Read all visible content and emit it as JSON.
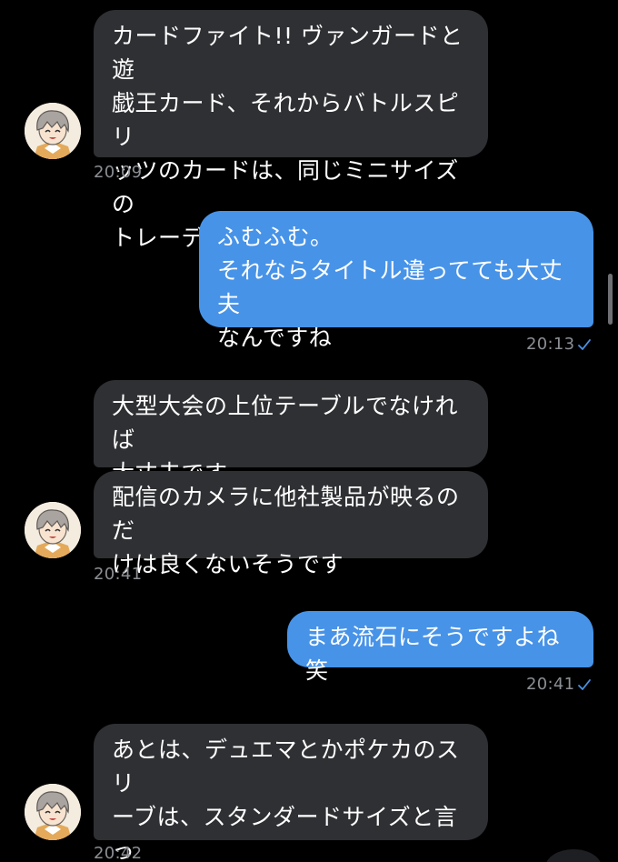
{
  "colors": {
    "background": "#000000",
    "incoming_bubble": "#2f3033",
    "outgoing_bubble": "#4793e8",
    "timestamp": "#8b8e93",
    "read_check": "#4793e8"
  },
  "messages": [
    {
      "direction": "incoming",
      "text": "カードファイト!! ヴァンガードと遊\n戯王カード、それからバトルスピリ\nッツのカードは、同じミニサイズの\nトレーディングカードなんです",
      "time": "20:09"
    },
    {
      "direction": "outgoing",
      "text": "ふむふむ。\nそれならタイトル違ってても大丈夫\nなんですね",
      "time": "20:13",
      "read": true
    },
    {
      "direction": "incoming",
      "text": "大型大会の上位テーブルでなければ\n大丈夫です"
    },
    {
      "direction": "incoming",
      "text": "配信のカメラに他社製品が映るのだ\nけは良くないそうです",
      "time": "20:41"
    },
    {
      "direction": "outgoing",
      "text": "まあ流石にそうですよね笑",
      "time": "20:41",
      "read": true
    },
    {
      "direction": "incoming",
      "text": "あとは、デュエマとかポケカのスリ\nーブは、スタンダードサイズと言っ\nてサイズが異なるのでダメです",
      "time": "20:42"
    }
  ],
  "icons": {
    "avatar": "cartoon-avatar-icon",
    "read_receipt": "checkmark-icon"
  }
}
